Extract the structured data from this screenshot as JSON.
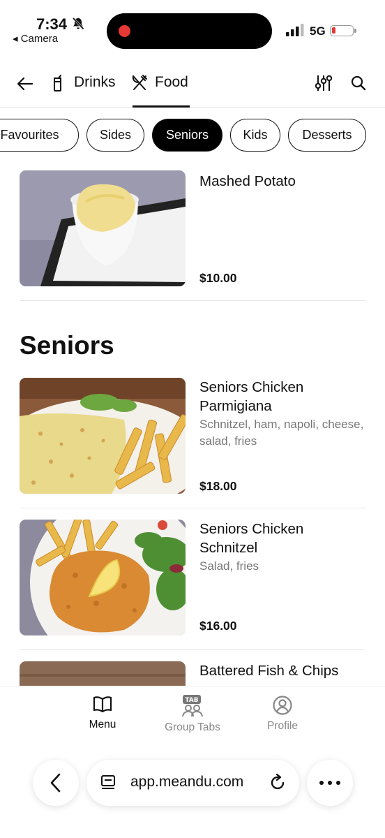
{
  "status_bar": {
    "time": "7:34",
    "back_app": "◂ Camera",
    "network": "5G"
  },
  "nav": {
    "tabs": [
      {
        "label": "Drinks",
        "icon": "drink-icon"
      },
      {
        "label": "Food",
        "icon": "utensils-icon",
        "active": true
      }
    ]
  },
  "chips": [
    {
      "label": "Favourites"
    },
    {
      "label": "Sides"
    },
    {
      "label": "Seniors",
      "active": true
    },
    {
      "label": "Kids"
    },
    {
      "label": "Desserts"
    }
  ],
  "items_top": [
    {
      "name": "Mashed Potato",
      "description": "",
      "price": "$10.00"
    }
  ],
  "section": {
    "title": "Seniors"
  },
  "items": [
    {
      "name": "Seniors Chicken Parmigiana",
      "description": "Schnitzel, ham, napoli, cheese, salad, fries",
      "price": "$18.00"
    },
    {
      "name": "Seniors Chicken Schnitzel",
      "description": "Salad, fries",
      "price": "$16.00"
    },
    {
      "name": "Battered Fish & Chips",
      "description": "",
      "price": ""
    }
  ],
  "bottom_tabs": [
    {
      "label": "Menu",
      "icon": "menu-book-icon",
      "active": true
    },
    {
      "label": "Group Tabs",
      "icon": "group-tabs-icon",
      "badge": "TAB"
    },
    {
      "label": "Profile",
      "icon": "profile-icon"
    }
  ],
  "browser": {
    "url": "app.meandu.com"
  },
  "colors": {
    "accent": "#000000",
    "muted_text": "#777777",
    "record": "#e53935"
  }
}
